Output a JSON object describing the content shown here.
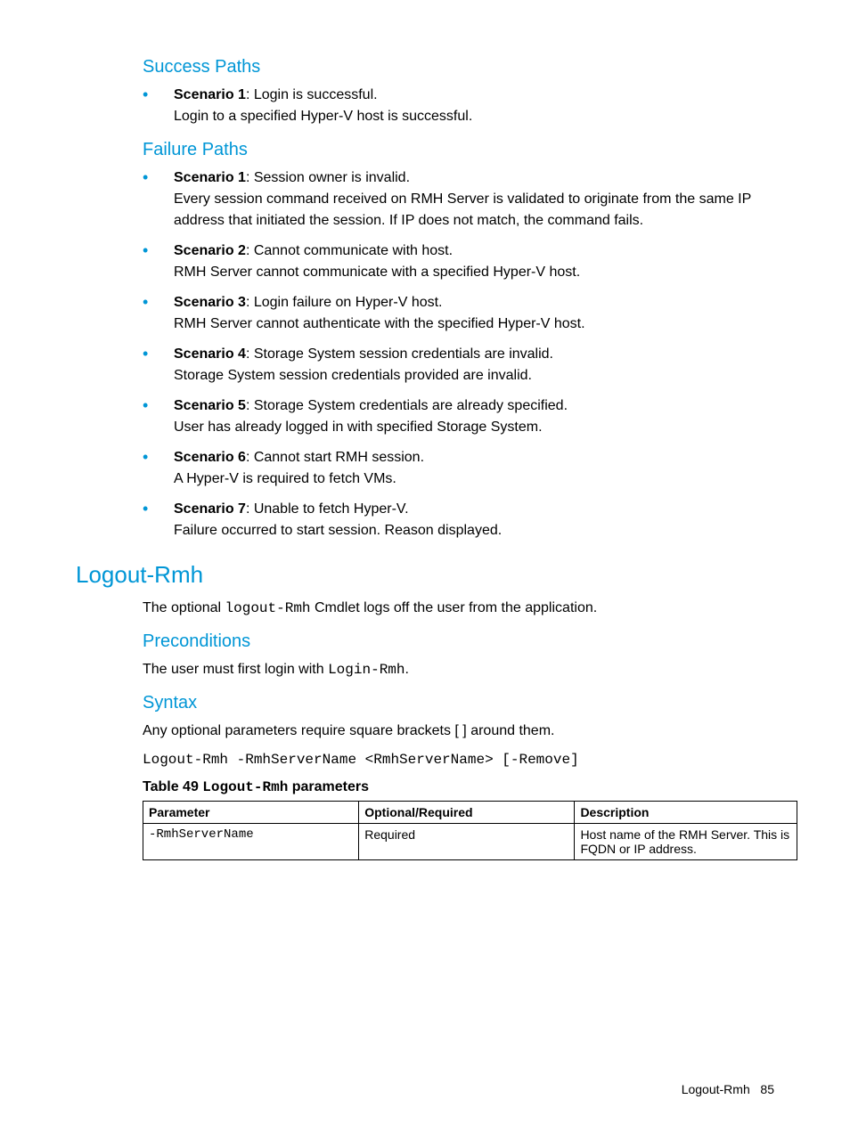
{
  "success": {
    "heading": "Success Paths",
    "items": [
      {
        "label": "Scenario 1",
        "title": "Login is successful.",
        "detail": "Login to a specified Hyper-V host is successful."
      }
    ]
  },
  "failure": {
    "heading": "Failure Paths",
    "items": [
      {
        "label": "Scenario 1",
        "title": "Session owner is invalid.",
        "detail": "Every session command received on RMH Server is validated to originate from the same IP address that initiated the session. If IP does not match, the command fails."
      },
      {
        "label": "Scenario 2",
        "title": "Cannot communicate with host.",
        "detail": "RMH Server cannot communicate with a specified Hyper-V host."
      },
      {
        "label": "Scenario 3",
        "title": "Login failure on Hyper-V host.",
        "detail": "RMH Server cannot authenticate with the specified Hyper-V host."
      },
      {
        "label": "Scenario 4",
        "title": "Storage System session credentials are invalid.",
        "detail": "Storage System session credentials provided are invalid."
      },
      {
        "label": "Scenario 5",
        "title": "Storage System credentials are already specified.",
        "detail": "User has already logged in with specified Storage System."
      },
      {
        "label": "Scenario 6",
        "title": "Cannot start RMH session.",
        "detail": "A Hyper-V is required to fetch VMs."
      },
      {
        "label": "Scenario 7",
        "title": "Unable to fetch Hyper-V.",
        "detail": "Failure occurred to start session. Reason displayed."
      }
    ]
  },
  "logout": {
    "heading": "Logout-Rmh",
    "intro_pre": "The optional ",
    "intro_code": "logout-Rmh",
    "intro_post": " Cmdlet logs off the user from the application.",
    "pre_heading": "Preconditions",
    "pre_pre": "The user must first login with ",
    "pre_code": "Login-Rmh",
    "pre_post": ".",
    "syntax_heading": "Syntax",
    "syntax_note": "Any optional parameters require square brackets [ ] around them.",
    "syntax_code": "Logout-Rmh -RmhServerName <RmhServerName> [-Remove]",
    "table_caption_pre": "Table 49 ",
    "table_caption_code": "Logout-Rmh",
    "table_caption_post": " parameters",
    "table": {
      "headers": {
        "c1": "Parameter",
        "c2": "Optional/Required",
        "c3": "Description"
      },
      "rows": [
        {
          "c1": "-RmhServerName",
          "c2": "Required",
          "c3": "Host name of the RMH Server. This is FQDN or IP address."
        }
      ]
    }
  },
  "footer": {
    "title": "Logout-Rmh",
    "page": "85"
  }
}
